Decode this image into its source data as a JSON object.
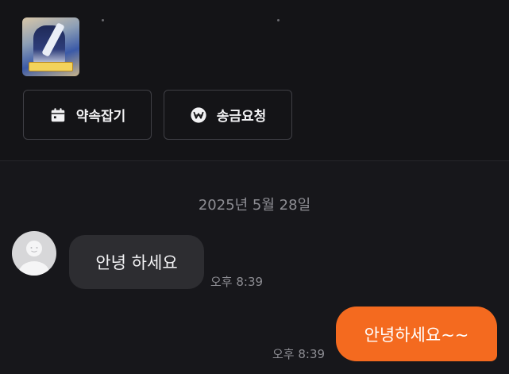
{
  "actions": {
    "schedule_label": "약속잡기",
    "remit_label": "송금요청"
  },
  "chat": {
    "date_separator": "2025년 5월 28일",
    "messages": [
      {
        "direction": "incoming",
        "text": "안녕 하세요",
        "time": "오후 8:39"
      },
      {
        "direction": "outgoing",
        "text": "안녕하세요~~",
        "time": "오후 8:39"
      }
    ]
  },
  "colors": {
    "background": "#17171b",
    "incoming_bubble": "#2d2d31",
    "outgoing_bubble": "#f46a1f",
    "muted_text": "#8d8d93"
  },
  "icons": {
    "schedule": "calendar-icon",
    "remit": "won-coin-icon",
    "avatar": "default-profile-icon"
  }
}
